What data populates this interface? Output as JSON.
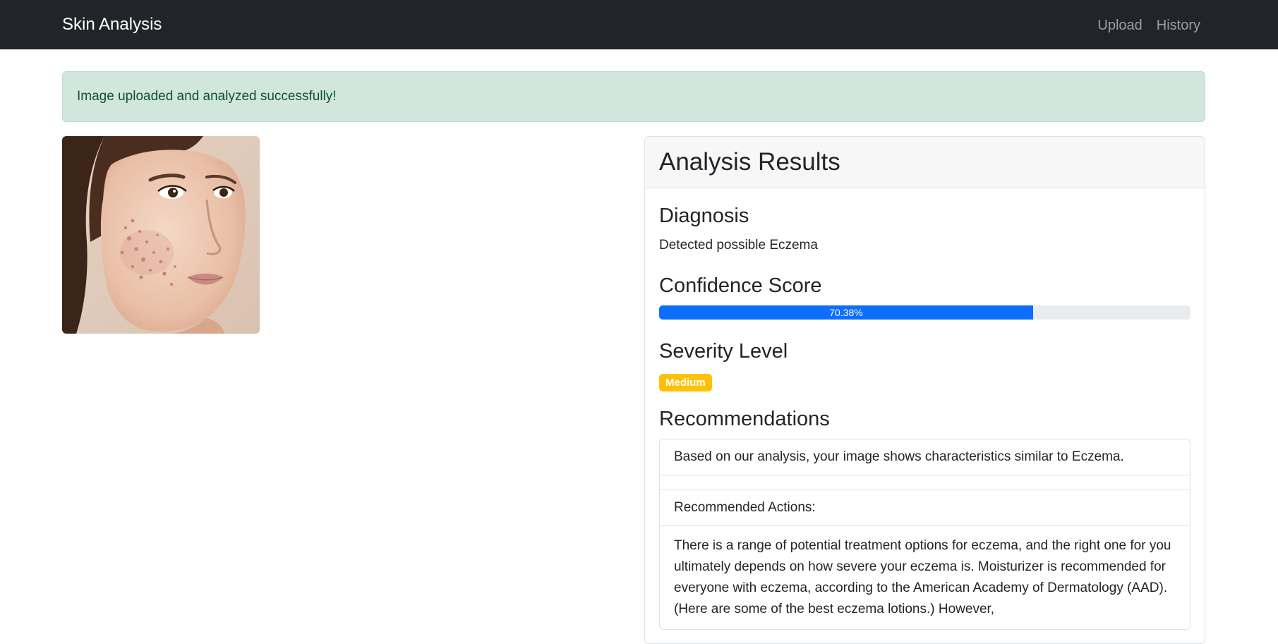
{
  "navbar": {
    "brand": "Skin Analysis",
    "links": [
      "Upload",
      "History"
    ]
  },
  "alert": {
    "message": "Image uploaded and analyzed successfully!"
  },
  "image": {
    "alt": "Uploaded face image"
  },
  "results": {
    "title": "Analysis Results",
    "diagnosis_heading": "Diagnosis",
    "diagnosis_text": "Detected possible Eczema",
    "confidence_heading": "Confidence Score",
    "confidence_label": "70.38%",
    "confidence_value": 70.38,
    "severity_heading": "Severity Level",
    "severity_badge": "Medium",
    "recommendations_heading": "Recommendations",
    "recommendation_summary": "Based on our analysis, your image shows characteristics similar to Eczema.",
    "recommended_actions_label": "Recommended Actions:",
    "recommendation_body": "There is a range of potential treatment options for eczema, and the right one for you ultimately depends on how severe your eczema is. Moisturizer is recommended for everyone with eczema, according to the American Academy of Dermatology (AAD). (Here are some of the best eczema lotions.) However,"
  },
  "colors": {
    "navbar_bg": "#212529",
    "alert_bg": "#d1e7dd",
    "alert_text": "#0f5132",
    "progress_fill": "#0d6efd",
    "badge_warning": "#ffc107"
  }
}
